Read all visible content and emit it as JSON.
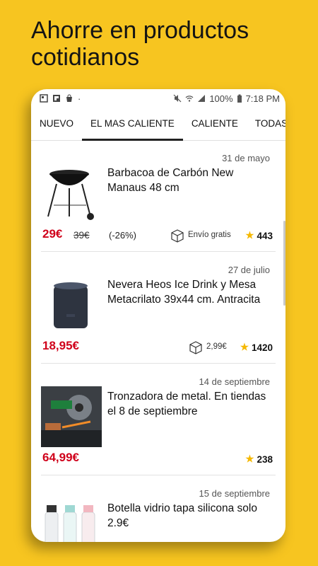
{
  "headline": {
    "line1": "Ahorre en productos",
    "line2": "cotidianos"
  },
  "statusbar": {
    "battery": "100%",
    "time": "7:18 PM"
  },
  "tabs": [
    "NUEVO",
    "EL MAS CALIENTE",
    "CALIENTE",
    "TODAS"
  ],
  "active_tab": "EL MAS CALIENTE",
  "deals": [
    {
      "date": "31 de mayo",
      "title": "Barbacoa de Carbón New Manaus 48 cm",
      "price": "29€",
      "old_price": "39€",
      "discount": "(-26%)",
      "shipping": "Envío gratis",
      "score": "443",
      "image": "charcoal-grill"
    },
    {
      "date": "27 de julio",
      "title": "Nevera Heos Ice Drink y Mesa Metacrilato 39x44 cm. Antracita",
      "price": "18,95€",
      "shipping": "2,99€",
      "score": "1420",
      "image": "drink-cooler"
    },
    {
      "date": "14 de septiembre",
      "title": "Tronzadora de metal. En tiendas el 8 de septiembre",
      "price": "64,99€",
      "score": "238",
      "image": "metal-cutoff-saw"
    },
    {
      "date": "15 de septiembre",
      "title": "Botella vidrio tapa silicona solo 2.9€",
      "image": "glass-bottles"
    }
  ],
  "colors": {
    "background": "#F7C520",
    "price": "#D0021B",
    "star": "#F5B800"
  }
}
